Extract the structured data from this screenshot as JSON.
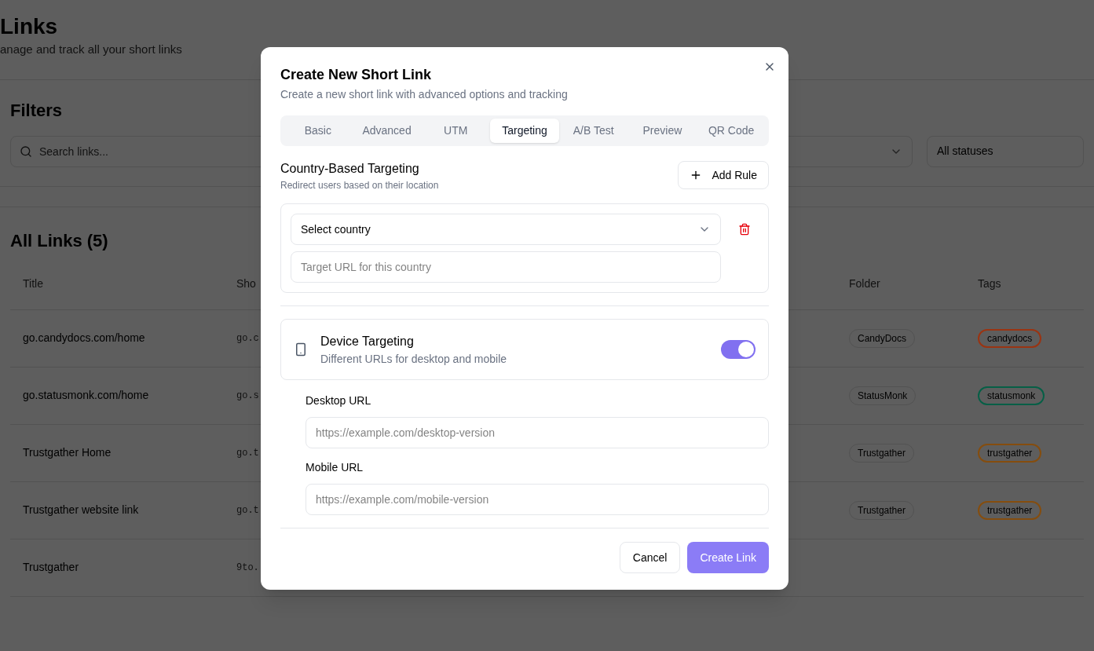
{
  "page": {
    "title": "Links",
    "subtitle": "anage and track all your short links"
  },
  "filters": {
    "title": "Filters",
    "search_placeholder": "Search links...",
    "status_select": "All statuses"
  },
  "links_table": {
    "title": "All Links (5)",
    "columns": [
      "Title",
      "Sho",
      "Folder",
      "Tags"
    ],
    "rows": [
      {
        "title": "go.candydocs.com/home",
        "short": "go.c",
        "folder": "CandyDocs",
        "tag": "candydocs",
        "color": "#9a3412"
      },
      {
        "title": "go.statusmonk.com/home",
        "short": "go.s",
        "folder": "StatusMonk",
        "tag": "statusmonk",
        "color": "#065f46"
      },
      {
        "title": "Trustgather Home",
        "short": "go.t",
        "folder": "Trustgather",
        "tag": "trustgather",
        "color": "#854d0e"
      },
      {
        "title": "Trustgather website link",
        "short": "go.t",
        "folder": "Trustgather",
        "tag": "trustgather",
        "color": "#854d0e"
      },
      {
        "title": "Trustgather",
        "short": "9to."
      }
    ]
  },
  "dialog": {
    "title": "Create New Short Link",
    "description": "Create a new short link with advanced options and tracking",
    "tabs": [
      {
        "label": "Basic",
        "selected": false
      },
      {
        "label": "Advanced",
        "selected": false
      },
      {
        "label": "UTM",
        "selected": false
      },
      {
        "label": "Targeting",
        "selected": true
      },
      {
        "label": "A/B Test",
        "selected": false
      },
      {
        "label": "Preview",
        "selected": false
      },
      {
        "label": "QR Code",
        "selected": false
      }
    ],
    "country": {
      "title": "Country-Based Targeting",
      "description": "Redirect users based on their location",
      "add_button": "Add Rule",
      "rules": [
        {
          "country": "Select country",
          "url_placeholder": "Target URL for this country"
        }
      ]
    },
    "device": {
      "title": "Device Targeting",
      "description": "Different URLs for desktop and mobile",
      "on": true,
      "fields": [
        {
          "label": "Desktop URL",
          "placeholder": "https://example.com/desktop-version"
        },
        {
          "label": "Mobile URL",
          "placeholder": "https://example.com/mobile-version"
        }
      ]
    },
    "buttons": {
      "cancel": "Cancel",
      "create": "Create Link"
    }
  }
}
